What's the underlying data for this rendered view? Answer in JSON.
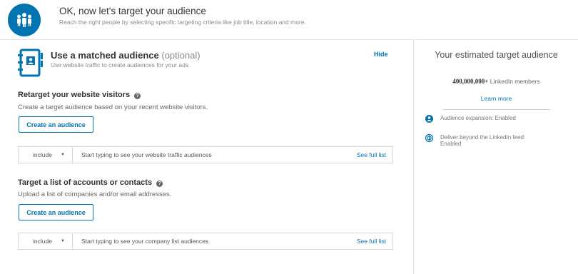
{
  "header": {
    "title": "OK, now let's target your audience",
    "subtitle": "Reach the right people by selecting specific targeting criteria like job title, location and more."
  },
  "matched": {
    "title": "Use a matched audience",
    "optional": "(optional)",
    "description": "Use website traffic to create audiences for your ads.",
    "hide_label": "Hide"
  },
  "retarget": {
    "title": "Retarget your website visitors",
    "description": "Create a target audience based on your recent website visitors.",
    "create_label": "Create an audience",
    "include_label": "include",
    "placeholder": "Start typing to see your website traffic audiences",
    "see_full_label": "See full list"
  },
  "accounts": {
    "title": "Target a list of accounts or contacts",
    "description": "Upload a list of companies and/or email addresses.",
    "create_label": "Create an audience",
    "include_label": "include",
    "placeholder": "Start typing to see your company list audiences",
    "see_full_label": "See full list"
  },
  "estimate": {
    "title": "Your estimated target audience",
    "count": "400,000,000+",
    "count_suffix": "LinkedIn members",
    "learn_more": "Learn more",
    "expansion": "Audience expansion: Enabled",
    "deliver": "Deliver beyond the LinkedIn feed: Enabled"
  },
  "colors": {
    "brand": "#0073b1"
  },
  "icons": {
    "header": "people-group-icon",
    "matched": "address-book-icon",
    "help": "question-circle-icon",
    "expansion": "person-circle-icon",
    "deliver": "overlapping-circles-icon",
    "caret": "caret-down-icon"
  }
}
